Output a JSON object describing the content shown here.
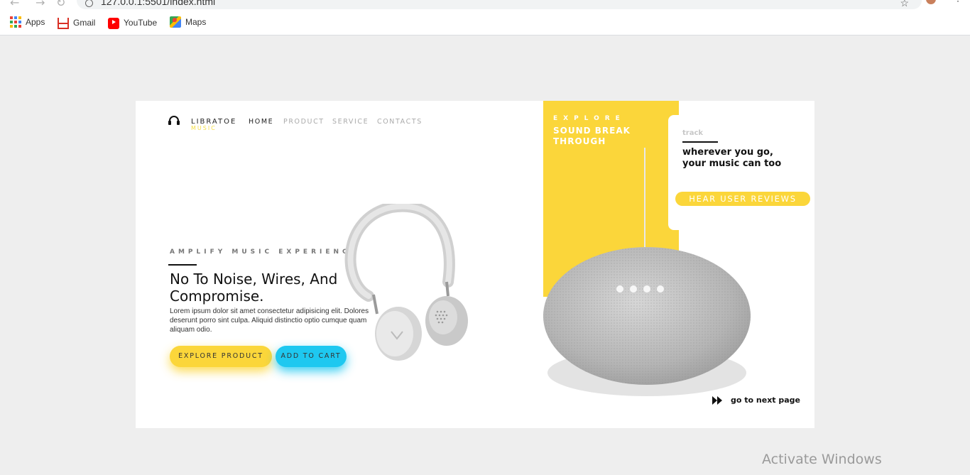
{
  "browser": {
    "url": "127.0.0.1:5501/index.html",
    "bookmarks": [
      {
        "label": "Apps",
        "icon": "apps-grid-icon"
      },
      {
        "label": "Gmail",
        "icon": "gmail-icon"
      },
      {
        "label": "YouTube",
        "icon": "youtube-icon"
      },
      {
        "label": "Maps",
        "icon": "maps-icon"
      }
    ]
  },
  "site": {
    "brand": "LIBRATOE",
    "brand_sub": "MUSIC",
    "nav": [
      "HOME",
      "PRODUCT",
      "SERVICE",
      "CONTACTS"
    ],
    "active_nav": "HOME"
  },
  "hero": {
    "kicker": "AMPLIFY MUSIC EXPERIENCE",
    "headline": "No To Noise, Wires, And Compromise.",
    "body": "Lorem ipsum dolor sit amet consectetur adipisicing elit. Dolores deserunt porro sint culpa. Aliquid distinctio optio cumque quam aliquam odio.",
    "primary_button": "EXPLORE PRODUCT",
    "secondary_button": "ADD TO CART"
  },
  "side": {
    "explore": "EXPLORE",
    "heading": "SOUND BREAK THROUGH",
    "track_label": "track",
    "tagline": "wherever you go, your music can too",
    "reviews_button": "HEAR USER REVIEWS",
    "next_label": "go to next page"
  },
  "system": {
    "watermark": "Activate Windows"
  },
  "colors": {
    "accent_yellow": "#fbd63a",
    "accent_cyan": "#1ec8f0",
    "page_bg": "#eeeeee"
  }
}
